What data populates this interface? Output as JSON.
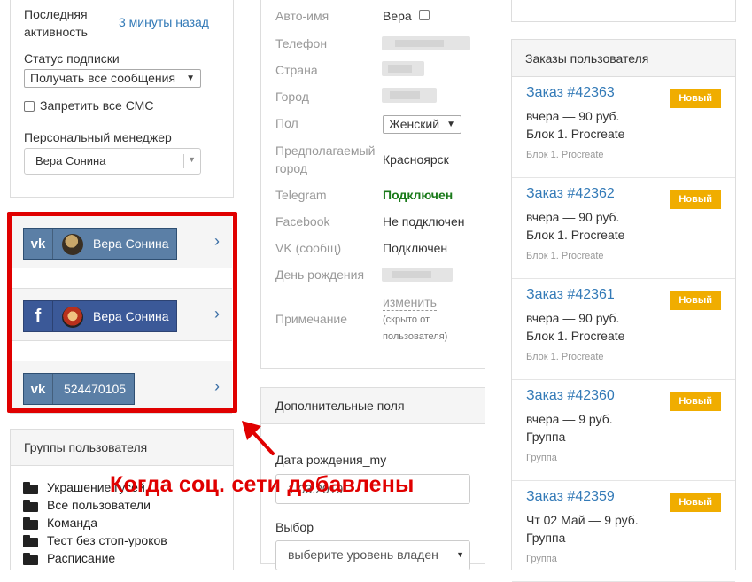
{
  "profile": {
    "last_activity_label": "Последняя активность",
    "last_activity_value": "3 минуты назад",
    "subscription_label": "Статус подписки",
    "subscription_value": "Получать все сообщения",
    "ban_sms_label": "Запретить все СМС",
    "manager_label": "Персональный менеджер",
    "manager_value": "Вера Сонина"
  },
  "social": [
    {
      "network": "VK",
      "logo_icon": "vk-icon",
      "name": "Вера Сонина",
      "color": "#5b7fa6"
    },
    {
      "network": "Facebook",
      "logo_icon": "facebook-icon",
      "name": "Вера Сонина",
      "color": "#3b5998"
    },
    {
      "network": "VK",
      "logo_icon": "vk-icon",
      "name": "524470105",
      "color": "#5b7fa6"
    }
  ],
  "groups": {
    "title": "Группы пользователя",
    "items": [
      "Украшение гусей",
      "Все пользователи",
      "Команда",
      "Тест без стоп-уроков",
      "Расписание"
    ]
  },
  "fields": {
    "avatar_name_label": "Авто-имя",
    "avatar_name_value": "Вера",
    "phone_label": "Телефон",
    "country_label": "Страна",
    "city_label": "Город",
    "gender_label": "Пол",
    "gender_value": "Женский",
    "estimated_city_label": "Предполагаемый город",
    "estimated_city_value": "Красноярск",
    "telegram_label": "Telegram",
    "telegram_value": "Подключен",
    "facebook_label": "Facebook",
    "facebook_value": "Не подключен",
    "vk_label": "VK (сообщ)",
    "vk_value": "Подключен",
    "birthday_label": "День рождения",
    "note_label": "Примечание",
    "note_edit": "изменить",
    "note_hint": "(скрыто от пользователя)"
  },
  "extra_fields": {
    "title": "Дополнительные поля",
    "birthday_my_label": "Дата рождения_my",
    "birthday_my_value": "1 03.2019",
    "choice_label": "Выбор",
    "choice_placeholder": "выберите уровень владен"
  },
  "orders": {
    "title": "Заказы пользователя",
    "items": [
      {
        "title": "Заказ #42363",
        "meta": "вчера — 90 руб.",
        "product": "Блок 1. Procreate",
        "sub": "Блок 1. Procreate",
        "status": "Новый"
      },
      {
        "title": "Заказ #42362",
        "meta": "вчера — 90 руб.",
        "product": "Блок 1. Procreate",
        "sub": "Блок 1. Procreate",
        "status": "Новый"
      },
      {
        "title": "Заказ #42361",
        "meta": "вчера — 90 руб.",
        "product": "Блок 1. Procreate",
        "sub": "Блок 1. Procreate",
        "status": "Новый"
      },
      {
        "title": "Заказ #42360",
        "meta": "вчера — 9 руб.",
        "product": "Группа",
        "sub": "Группа",
        "status": "Новый"
      },
      {
        "title": "Заказ #42359",
        "meta": "Чт 02 Май — 9 руб.",
        "product": "Группа",
        "sub": "Группа",
        "status": "Новый"
      }
    ]
  },
  "annotation": {
    "caption": "Когда соц. сети добавлены",
    "color": "#e00000"
  },
  "colors": {
    "link": "#337ab7",
    "badge": "#f0ad00",
    "telegram_connected": "#1a7a1a"
  }
}
